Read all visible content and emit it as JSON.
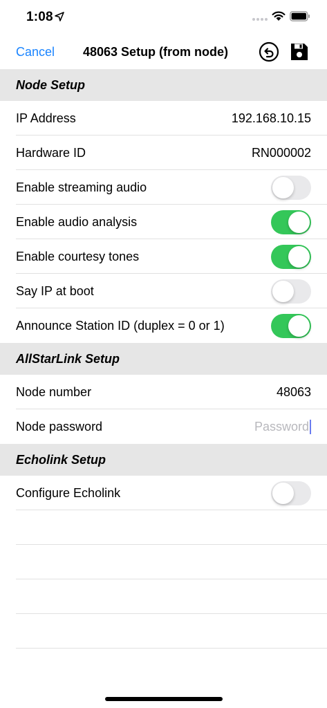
{
  "status_bar": {
    "time": "1:08",
    "icons": [
      "location-arrow-icon",
      "signal-icon",
      "wifi-icon",
      "battery-icon"
    ]
  },
  "nav": {
    "cancel_label": "Cancel",
    "title": "48063 Setup (from node)",
    "icons": [
      "undo-icon",
      "save-icon"
    ]
  },
  "colors": {
    "accent": "#1a84ff",
    "toggle_on": "#34c759",
    "toggle_off": "#e9e9eb",
    "section_bg": "#e6e6e6"
  },
  "sections": {
    "node": {
      "title": "Node Setup",
      "ip_label": "IP Address",
      "ip_value": "192.168.10.15",
      "hw_label": "Hardware ID",
      "hw_value": "RN000002",
      "streaming_label": "Enable streaming audio",
      "streaming_on": false,
      "analysis_label": "Enable audio analysis",
      "analysis_on": true,
      "courtesy_label": "Enable courtesy tones",
      "courtesy_on": true,
      "sayip_label": "Say IP at boot",
      "sayip_on": false,
      "announce_label": "Announce Station ID (duplex = 0 or 1)",
      "announce_on": true
    },
    "allstar": {
      "title": "AllStarLink Setup",
      "node_number_label": "Node number",
      "node_number_value": "48063",
      "password_label": "Node password",
      "password_value": "",
      "password_placeholder": "Password"
    },
    "echolink": {
      "title": "Echolink Setup",
      "configure_label": "Configure Echolink",
      "configure_on": false
    }
  }
}
